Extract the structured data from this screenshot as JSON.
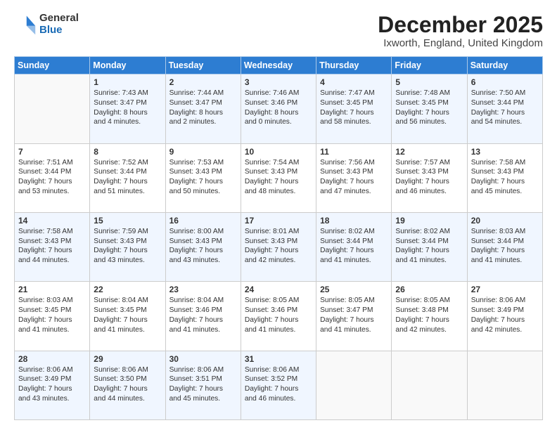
{
  "header": {
    "logo_general": "General",
    "logo_blue": "Blue",
    "month_title": "December 2025",
    "location": "Ixworth, England, United Kingdom"
  },
  "days_of_week": [
    "Sunday",
    "Monday",
    "Tuesday",
    "Wednesday",
    "Thursday",
    "Friday",
    "Saturday"
  ],
  "rows": [
    [
      {
        "day": "",
        "lines": []
      },
      {
        "day": "1",
        "lines": [
          "Sunrise: 7:43 AM",
          "Sunset: 3:47 PM",
          "Daylight: 8 hours",
          "and 4 minutes."
        ]
      },
      {
        "day": "2",
        "lines": [
          "Sunrise: 7:44 AM",
          "Sunset: 3:47 PM",
          "Daylight: 8 hours",
          "and 2 minutes."
        ]
      },
      {
        "day": "3",
        "lines": [
          "Sunrise: 7:46 AM",
          "Sunset: 3:46 PM",
          "Daylight: 8 hours",
          "and 0 minutes."
        ]
      },
      {
        "day": "4",
        "lines": [
          "Sunrise: 7:47 AM",
          "Sunset: 3:45 PM",
          "Daylight: 7 hours",
          "and 58 minutes."
        ]
      },
      {
        "day": "5",
        "lines": [
          "Sunrise: 7:48 AM",
          "Sunset: 3:45 PM",
          "Daylight: 7 hours",
          "and 56 minutes."
        ]
      },
      {
        "day": "6",
        "lines": [
          "Sunrise: 7:50 AM",
          "Sunset: 3:44 PM",
          "Daylight: 7 hours",
          "and 54 minutes."
        ]
      }
    ],
    [
      {
        "day": "7",
        "lines": [
          "Sunrise: 7:51 AM",
          "Sunset: 3:44 PM",
          "Daylight: 7 hours",
          "and 53 minutes."
        ]
      },
      {
        "day": "8",
        "lines": [
          "Sunrise: 7:52 AM",
          "Sunset: 3:44 PM",
          "Daylight: 7 hours",
          "and 51 minutes."
        ]
      },
      {
        "day": "9",
        "lines": [
          "Sunrise: 7:53 AM",
          "Sunset: 3:43 PM",
          "Daylight: 7 hours",
          "and 50 minutes."
        ]
      },
      {
        "day": "10",
        "lines": [
          "Sunrise: 7:54 AM",
          "Sunset: 3:43 PM",
          "Daylight: 7 hours",
          "and 48 minutes."
        ]
      },
      {
        "day": "11",
        "lines": [
          "Sunrise: 7:56 AM",
          "Sunset: 3:43 PM",
          "Daylight: 7 hours",
          "and 47 minutes."
        ]
      },
      {
        "day": "12",
        "lines": [
          "Sunrise: 7:57 AM",
          "Sunset: 3:43 PM",
          "Daylight: 7 hours",
          "and 46 minutes."
        ]
      },
      {
        "day": "13",
        "lines": [
          "Sunrise: 7:58 AM",
          "Sunset: 3:43 PM",
          "Daylight: 7 hours",
          "and 45 minutes."
        ]
      }
    ],
    [
      {
        "day": "14",
        "lines": [
          "Sunrise: 7:58 AM",
          "Sunset: 3:43 PM",
          "Daylight: 7 hours",
          "and 44 minutes."
        ]
      },
      {
        "day": "15",
        "lines": [
          "Sunrise: 7:59 AM",
          "Sunset: 3:43 PM",
          "Daylight: 7 hours",
          "and 43 minutes."
        ]
      },
      {
        "day": "16",
        "lines": [
          "Sunrise: 8:00 AM",
          "Sunset: 3:43 PM",
          "Daylight: 7 hours",
          "and 43 minutes."
        ]
      },
      {
        "day": "17",
        "lines": [
          "Sunrise: 8:01 AM",
          "Sunset: 3:43 PM",
          "Daylight: 7 hours",
          "and 42 minutes."
        ]
      },
      {
        "day": "18",
        "lines": [
          "Sunrise: 8:02 AM",
          "Sunset: 3:44 PM",
          "Daylight: 7 hours",
          "and 41 minutes."
        ]
      },
      {
        "day": "19",
        "lines": [
          "Sunrise: 8:02 AM",
          "Sunset: 3:44 PM",
          "Daylight: 7 hours",
          "and 41 minutes."
        ]
      },
      {
        "day": "20",
        "lines": [
          "Sunrise: 8:03 AM",
          "Sunset: 3:44 PM",
          "Daylight: 7 hours",
          "and 41 minutes."
        ]
      }
    ],
    [
      {
        "day": "21",
        "lines": [
          "Sunrise: 8:03 AM",
          "Sunset: 3:45 PM",
          "Daylight: 7 hours",
          "and 41 minutes."
        ]
      },
      {
        "day": "22",
        "lines": [
          "Sunrise: 8:04 AM",
          "Sunset: 3:45 PM",
          "Daylight: 7 hours",
          "and 41 minutes."
        ]
      },
      {
        "day": "23",
        "lines": [
          "Sunrise: 8:04 AM",
          "Sunset: 3:46 PM",
          "Daylight: 7 hours",
          "and 41 minutes."
        ]
      },
      {
        "day": "24",
        "lines": [
          "Sunrise: 8:05 AM",
          "Sunset: 3:46 PM",
          "Daylight: 7 hours",
          "and 41 minutes."
        ]
      },
      {
        "day": "25",
        "lines": [
          "Sunrise: 8:05 AM",
          "Sunset: 3:47 PM",
          "Daylight: 7 hours",
          "and 41 minutes."
        ]
      },
      {
        "day": "26",
        "lines": [
          "Sunrise: 8:05 AM",
          "Sunset: 3:48 PM",
          "Daylight: 7 hours",
          "and 42 minutes."
        ]
      },
      {
        "day": "27",
        "lines": [
          "Sunrise: 8:06 AM",
          "Sunset: 3:49 PM",
          "Daylight: 7 hours",
          "and 42 minutes."
        ]
      }
    ],
    [
      {
        "day": "28",
        "lines": [
          "Sunrise: 8:06 AM",
          "Sunset: 3:49 PM",
          "Daylight: 7 hours",
          "and 43 minutes."
        ]
      },
      {
        "day": "29",
        "lines": [
          "Sunrise: 8:06 AM",
          "Sunset: 3:50 PM",
          "Daylight: 7 hours",
          "and 44 minutes."
        ]
      },
      {
        "day": "30",
        "lines": [
          "Sunrise: 8:06 AM",
          "Sunset: 3:51 PM",
          "Daylight: 7 hours",
          "and 45 minutes."
        ]
      },
      {
        "day": "31",
        "lines": [
          "Sunrise: 8:06 AM",
          "Sunset: 3:52 PM",
          "Daylight: 7 hours",
          "and 46 minutes."
        ]
      },
      {
        "day": "",
        "lines": []
      },
      {
        "day": "",
        "lines": []
      },
      {
        "day": "",
        "lines": []
      }
    ]
  ]
}
